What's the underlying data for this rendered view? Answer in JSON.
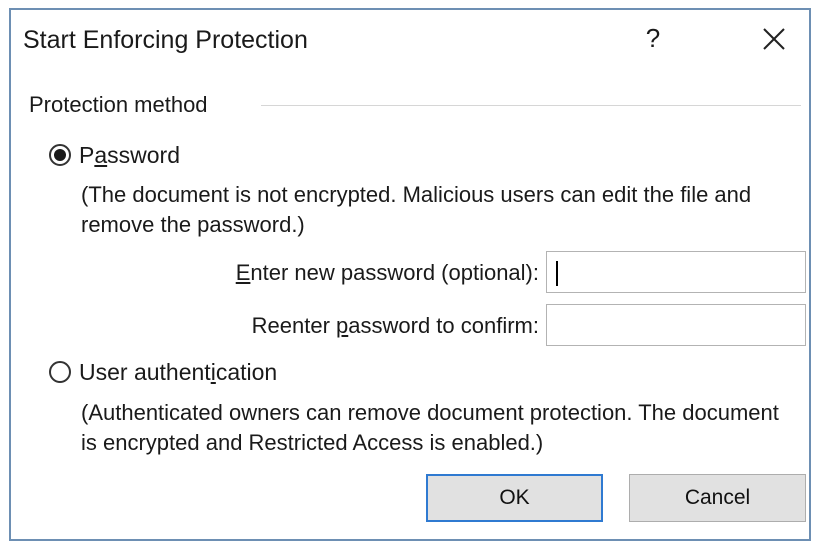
{
  "dialog": {
    "title": "Start Enforcing Protection",
    "help_label": "?",
    "close_label": "✕"
  },
  "protection": {
    "group_label": "Protection method",
    "password_option": {
      "label": "Password",
      "label_pre": "P",
      "label_accel": "a",
      "label_post": "ssword",
      "checked": true,
      "note": "(The document is not encrypted. Malicious users can edit the file and remove the password.)"
    },
    "new_password": {
      "label_pre": "",
      "label_accel": "E",
      "label_post": "nter new password (optional):",
      "value": ""
    },
    "confirm_password": {
      "label_pre": "Reenter ",
      "label_accel": "p",
      "label_post": "assword to confirm:",
      "value": ""
    },
    "user_auth_option": {
      "label": "User authentication",
      "label_pre": "User authent",
      "label_accel": "i",
      "label_post": "cation",
      "checked": false,
      "note": "(Authenticated owners can remove document protection. The document is encrypted and Restricted Access is enabled.)"
    }
  },
  "buttons": {
    "ok_label": "OK",
    "cancel_label": "Cancel"
  },
  "colors": {
    "dialog_border": "#6d8fb3",
    "default_button_border": "#2f7ad1",
    "button_face": "#e1e1e1"
  }
}
